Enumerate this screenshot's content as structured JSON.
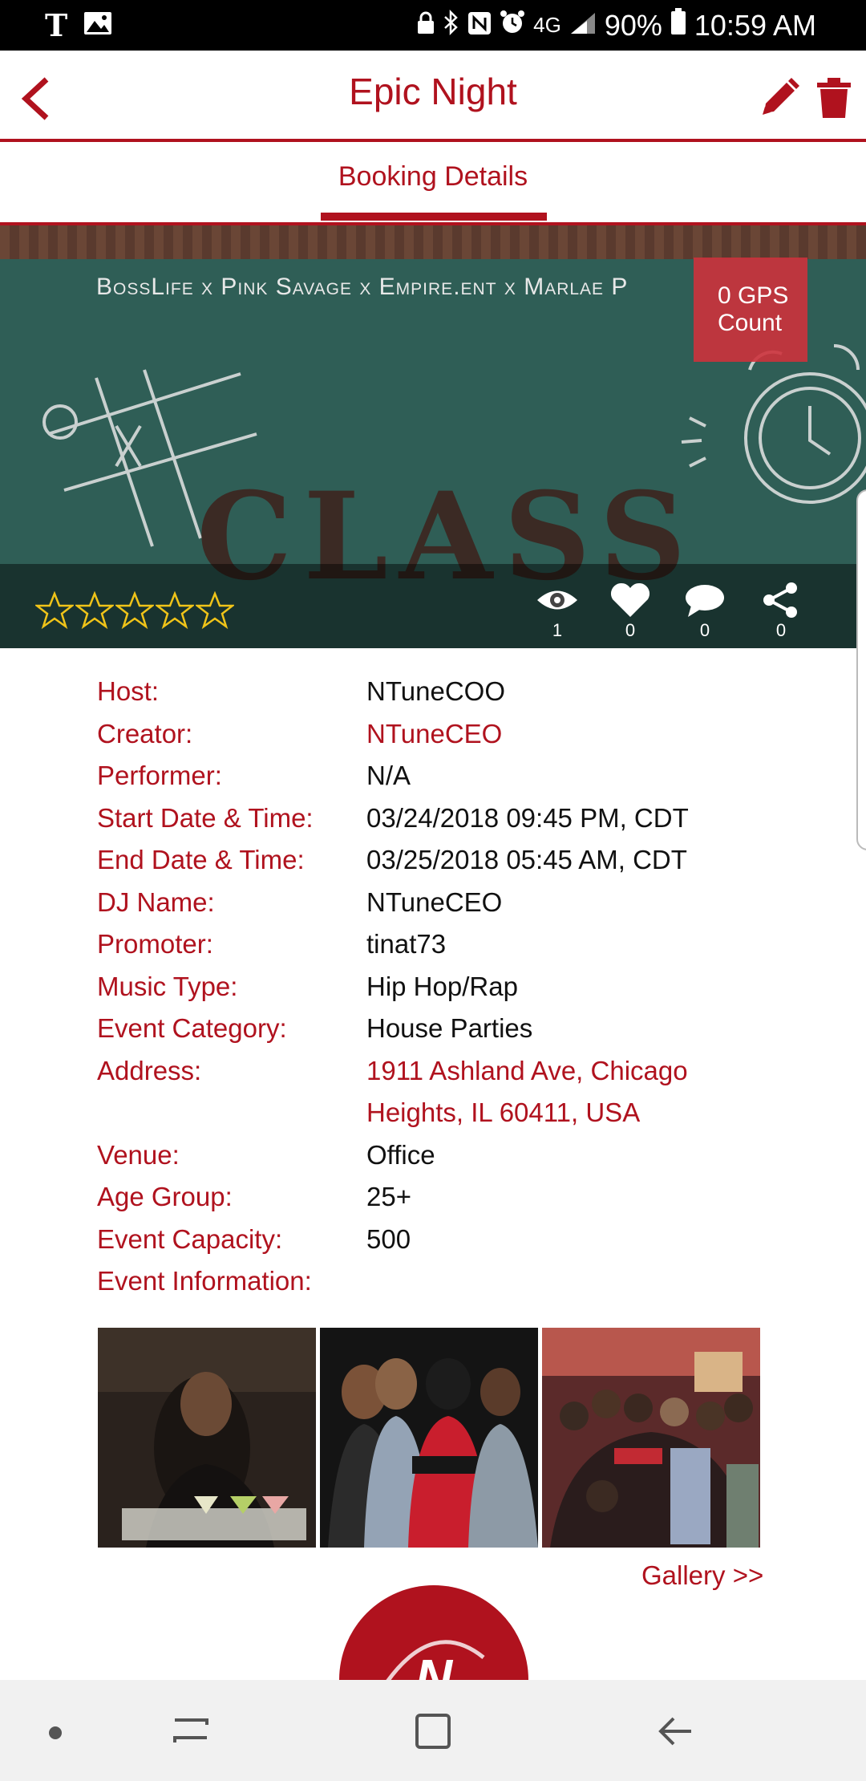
{
  "status_bar": {
    "carrier": "T",
    "network": "4G",
    "battery": "90%",
    "time": "10:59 AM"
  },
  "app_bar": {
    "title": "Epic Night",
    "icons": [
      "back-chevron-icon",
      "pencil-icon",
      "trash-icon"
    ]
  },
  "tabs": [
    {
      "label": "Booking Details",
      "active": true
    }
  ],
  "banner": {
    "chalk_text": "BossLife x Pink Savage x Empire.ent x Marlae P",
    "headline": "CLASS",
    "gps_count": "0",
    "gps_label": "GPS",
    "gps_label_2": "Count",
    "rating_stars": 0,
    "stats": {
      "views": "1",
      "likes": "0",
      "comments": "0",
      "shares": "0"
    }
  },
  "details": [
    {
      "label": "Host:",
      "value": "NTuneCOO",
      "link": false
    },
    {
      "label": "Creator:",
      "value": "NTuneCEO",
      "link": true
    },
    {
      "label": "Performer:",
      "value": "N/A",
      "link": false
    },
    {
      "label": "Start Date & Time:",
      "value": "03/24/2018 09:45 PM, CDT",
      "link": false
    },
    {
      "label": "End Date & Time:",
      "value": "03/25/2018 05:45 AM, CDT",
      "link": false
    },
    {
      "label": "DJ Name:",
      "value": "NTuneCEO",
      "link": false
    },
    {
      "label": "Promoter:",
      "value": "tinat73",
      "link": false
    },
    {
      "label": "Music Type:",
      "value": "Hip Hop/Rap",
      "link": false
    },
    {
      "label": "Event Category:",
      "value": "House Parties",
      "link": false
    },
    {
      "label": "Address:",
      "value": "1911 Ashland Ave, Chicago",
      "value2": "Heights, IL 60411, USA",
      "link": true
    },
    {
      "label": "Venue:",
      "value": "Office",
      "link": false
    },
    {
      "label": "Age Group:",
      "value": "25+",
      "link": false
    },
    {
      "label": "Event Capacity:",
      "value": "500",
      "link": false
    },
    {
      "label": "Event Information:",
      "value": "",
      "link": false
    }
  ],
  "gallery": {
    "link_label": "Gallery >>",
    "photos": [
      "photo-1",
      "photo-2",
      "photo-3"
    ]
  },
  "logo": {
    "letter": "N"
  },
  "colors": {
    "brand_red": "#b0121e",
    "text_dark": "#111111",
    "chalkboard": "#2f5e56"
  }
}
